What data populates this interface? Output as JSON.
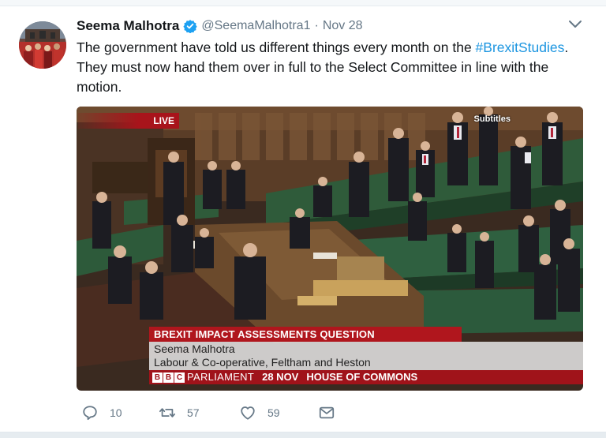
{
  "tweet": {
    "author_name": "Seema Malhotra",
    "handle": "@SeemaMalhotra1",
    "separator": "·",
    "date": "Nov 28",
    "text_before": "The government have told us different things every month on the ",
    "hashtag": "#BrexitStudies",
    "text_after": ". They must now hand them over in full to the Select Committee in line with the motion."
  },
  "media": {
    "live_label": "LIVE",
    "subtitles_label": "Subtitles",
    "topic": "BREXIT IMPACT ASSESSMENTS QUESTION",
    "caption_name": "Seema Malhotra",
    "caption_role": "Labour & Co-operative, Feltham and Heston",
    "bbc_letters": [
      "B",
      "B",
      "C"
    ],
    "channel": "PARLIAMENT",
    "broadcast_date": "28 NOV",
    "location": "HOUSE OF COMMONS"
  },
  "actions": {
    "replies": "10",
    "retweets": "57",
    "likes": "59"
  },
  "colors": {
    "hashtag": "#1b95e0",
    "verified": "#1da1f2",
    "muted": "#657786",
    "bbc_red": "#a0131a"
  },
  "icons": {
    "verified": "verified-badge-icon",
    "more": "chevron-down-icon",
    "reply": "reply-icon",
    "retweet": "retweet-icon",
    "like": "heart-icon",
    "dm": "envelope-icon"
  }
}
